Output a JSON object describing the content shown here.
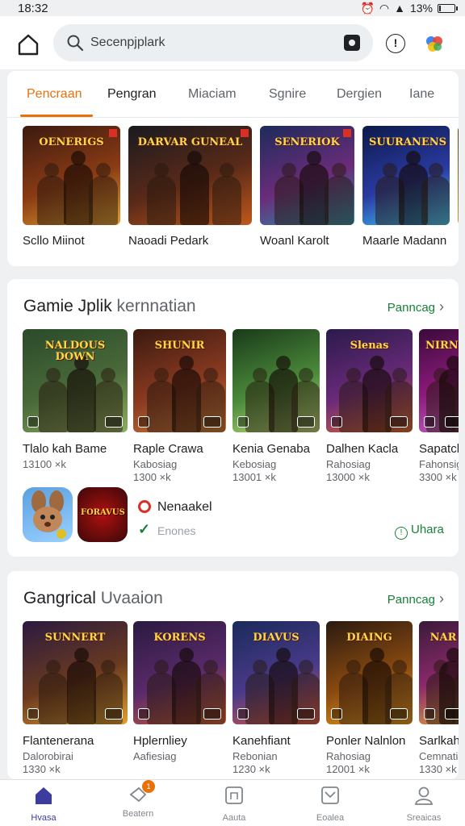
{
  "status": {
    "time": "18:32",
    "battery": "13%",
    "battery_fraction": 0.13
  },
  "search": {
    "placeholder": "Secenpjplark"
  },
  "category_tabs": [
    {
      "label": "Pencraan",
      "active": true
    },
    {
      "label": "Pengran"
    },
    {
      "label": "Miaciam"
    },
    {
      "label": "Sgnire"
    },
    {
      "label": "Dergien"
    },
    {
      "label": "Iane"
    }
  ],
  "featured": [
    {
      "emblem": "OENERIGS",
      "title": "Scllo Miinot",
      "colors": [
        "#3b1a10",
        "#8a3b14",
        "#e0a030"
      ]
    },
    {
      "emblem": "DARVAR GUNEAL",
      "title": "Naoadi Pedark",
      "colors": [
        "#1a1a1f",
        "#5a2a18",
        "#c0581c"
      ]
    },
    {
      "emblem": "SENERIOK",
      "title": "Woanl Karolt",
      "colors": [
        "#1d2b5a",
        "#6a2c7a",
        "#2a8fa8"
      ]
    },
    {
      "emblem": "SUURANENS",
      "title": "Maarle Madann",
      "colors": [
        "#0c1a4a",
        "#2a3aa0",
        "#3fd0ff"
      ]
    },
    {
      "emblem": "",
      "title": "N",
      "colors": [
        "#5a3a10",
        "#a06a20",
        "#e0a040"
      ]
    }
  ],
  "section1": {
    "title_main": "Gamie Jplik",
    "title_light": "kernnatian",
    "link": "Panncag",
    "games": [
      {
        "emblem": "NALDOUS DOWN",
        "title": "Tlalo kah Bame",
        "sub1": "13100 ×k",
        "sub2": "",
        "colors": [
          "#2a4a2a",
          "#4a6a3a",
          "#8ab060"
        ]
      },
      {
        "emblem": "SHUNIR",
        "title": "Raple Crawa",
        "sub1": "Kabosiag",
        "sub2": "1300 ×k",
        "colors": [
          "#3a1a10",
          "#8a3a20",
          "#d0803a"
        ]
      },
      {
        "emblem": "",
        "title": "Kenia Genaba",
        "sub1": "Kebosiag",
        "sub2": "13001 ×k",
        "colors": [
          "#1a3a1a",
          "#4a8a3a",
          "#c0e080"
        ]
      },
      {
        "emblem": "Slenas",
        "title": "Dalhen Kacla",
        "sub1": "Rahosiag",
        "sub2": "13000 ×k",
        "colors": [
          "#2a1a4a",
          "#6a2a7a",
          "#e06a30"
        ]
      },
      {
        "emblem": "NIRNG",
        "title": "Sapatch",
        "sub1": "Fahonsig",
        "sub2": "3300 ×k",
        "colors": [
          "#3a0a3a",
          "#8a1a7a",
          "#c060c0"
        ]
      }
    ],
    "promo": {
      "app1_colors": [
        "#5aa0e0",
        "#9ad0ff"
      ],
      "app2_emblem": "FORAVUS",
      "app2_colors": [
        "#3a0808",
        "#b01010"
      ],
      "name": "Nenaakel",
      "sub": "Enones",
      "action": "Uhara"
    }
  },
  "section2": {
    "title_main": "Gangrical",
    "title_light": "Uvaaion",
    "link": "Panncag",
    "games": [
      {
        "emblem": "SUNNERT",
        "title": "Flantenerana",
        "sub1": "Dalorobirai",
        "sub2": "1330 ×k",
        "colors": [
          "#2a1a40",
          "#6a3a20",
          "#e0a030"
        ]
      },
      {
        "emblem": "KORENS",
        "title": "Hplernliey",
        "sub1": "Aafiesiag",
        "sub2": "",
        "colors": [
          "#2a1a40",
          "#5a2a6a",
          "#d06030"
        ]
      },
      {
        "emblem": "DIAVUS",
        "title": "Kanehfiant",
        "sub1": "Rebonian",
        "sub2": "1230 ×k",
        "colors": [
          "#1a2a5a",
          "#4a3a8a",
          "#e05a40"
        ]
      },
      {
        "emblem": "DIAING",
        "title": "Ponler Nalnlon",
        "sub1": "Rahosiag",
        "sub2": "12001 ×k",
        "colors": [
          "#2a1a10",
          "#8a4a10",
          "#f0a020"
        ]
      },
      {
        "emblem": "NAR",
        "title": "Sarlkah",
        "sub1": "Cemnatig",
        "sub2": "1330 ×k",
        "colors": [
          "#3a1a3a",
          "#8a2a6a",
          "#e0a040"
        ]
      }
    ]
  },
  "nav": [
    {
      "label": "Hvasa",
      "icon": "home-icon",
      "active": true
    },
    {
      "label": "Beatern",
      "icon": "games-icon",
      "badge": "1"
    },
    {
      "label": "Aauta",
      "icon": "apps-icon"
    },
    {
      "label": "Eoalea",
      "icon": "offers-icon"
    },
    {
      "label": "Sreaicas",
      "icon": "profile-icon"
    }
  ],
  "accent": "#e8710a",
  "link_color": "#188038"
}
